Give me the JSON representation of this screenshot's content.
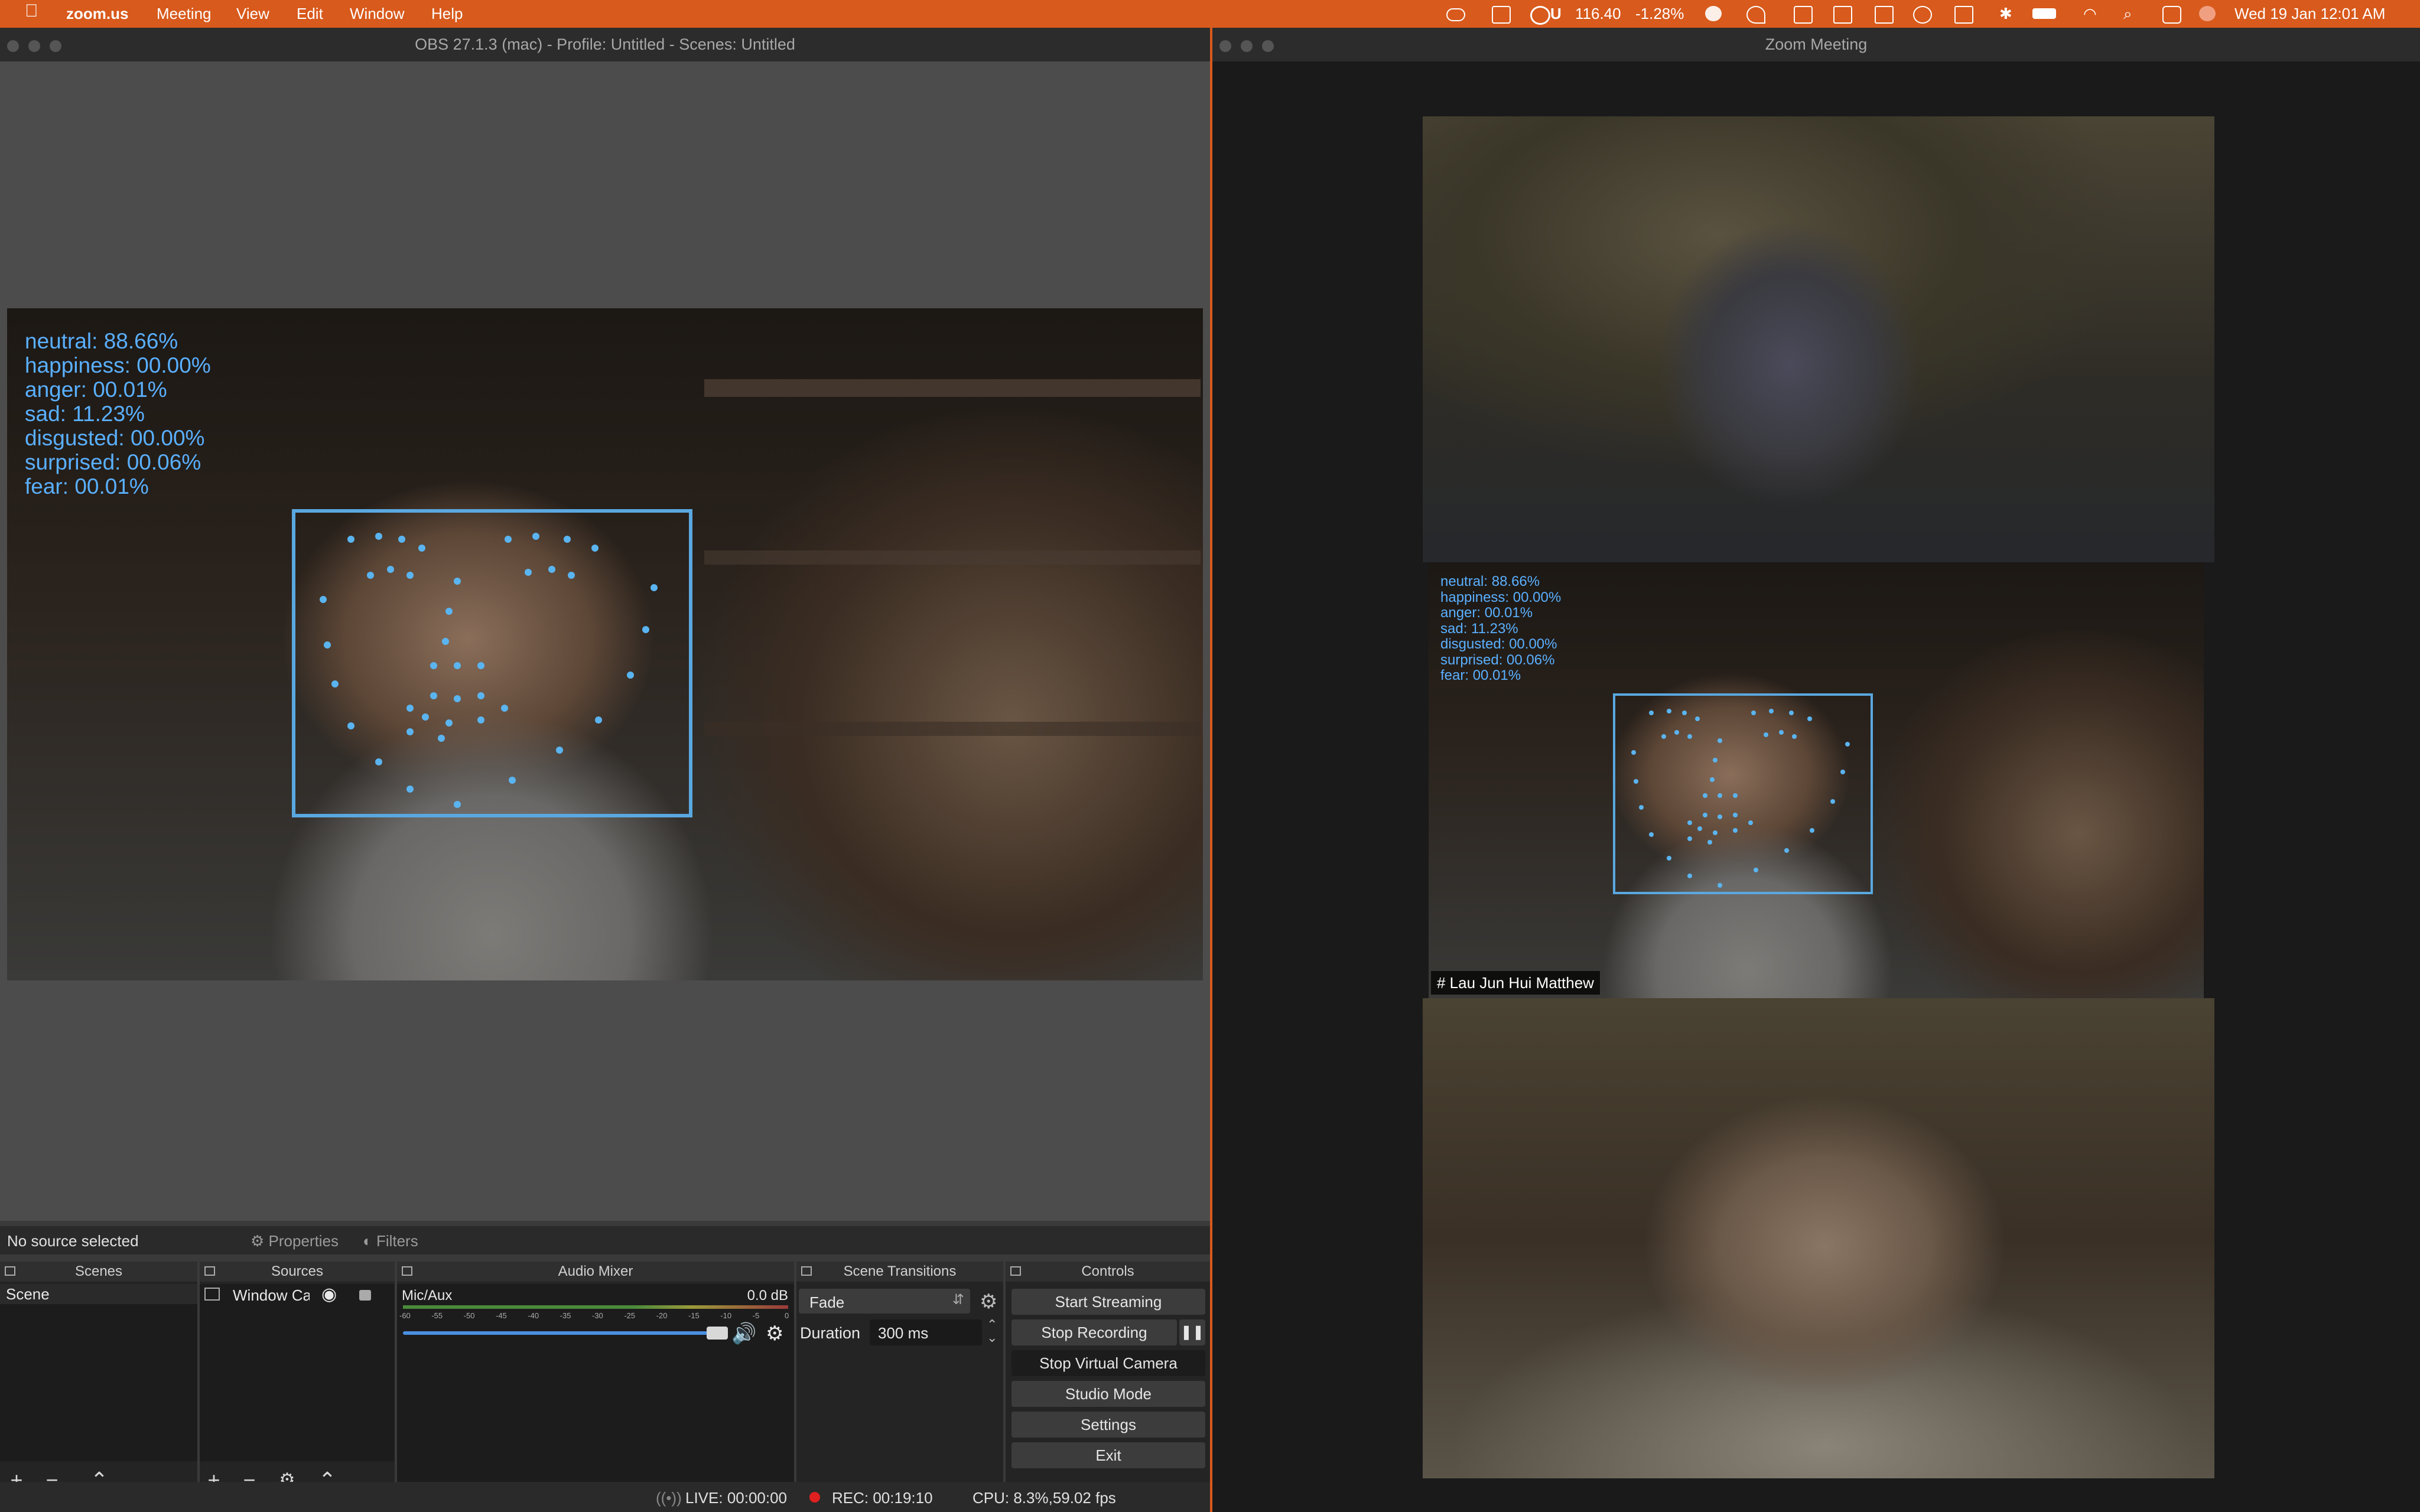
{
  "menubar": {
    "app": "zoom.us",
    "menus": [
      "Meeting",
      "View",
      "Edit",
      "Window",
      "Help"
    ],
    "stock": "116.40",
    "stock_change": "-1.28%",
    "stock_ticker": "U",
    "datetime": "Wed 19 Jan  12:01 AM"
  },
  "obs": {
    "title": "OBS 27.1.3 (mac) - Profile: Untitled - Scenes: Untitled",
    "emotions": [
      "neutral: 88.66%",
      "happiness: 00.00%",
      "anger: 00.01%",
      "sad: 11.23%",
      "disgusted: 00.00%",
      "surprised: 00.06%",
      "fear: 00.01%"
    ],
    "source_bar": {
      "no_source": "No source selected",
      "properties": "Properties",
      "filters": "Filters"
    },
    "scenes": {
      "title": "Scenes",
      "items": [
        "Scene"
      ]
    },
    "sources": {
      "title": "Sources",
      "items": [
        "Window Ca"
      ]
    },
    "audio": {
      "title": "Audio Mixer",
      "channel": "Mic/Aux",
      "db": "0.0 dB",
      "ticks": [
        "-60",
        "-55",
        "-50",
        "-45",
        "-40",
        "-35",
        "-30",
        "-25",
        "-20",
        "-15",
        "-10",
        "-5",
        "0"
      ]
    },
    "transitions": {
      "title": "Scene Transitions",
      "type": "Fade",
      "duration_label": "Duration",
      "duration": "300 ms"
    },
    "controls": {
      "title": "Controls",
      "start_streaming": "Start Streaming",
      "stop_recording": "Stop Recording",
      "stop_virtual_camera": "Stop Virtual Camera",
      "studio_mode": "Studio Mode",
      "settings": "Settings",
      "exit": "Exit"
    },
    "status": {
      "live": "LIVE: 00:00:00",
      "rec": "REC: 00:19:10",
      "cpu": "CPU: 8.3%,59.02 fps"
    }
  },
  "zoom": {
    "title": "Zoom Meeting",
    "participant": "# Lau Jun Hui Matthew"
  },
  "colors": {
    "menubar": "#d85a1c",
    "emotion_text": "#5ab0ff",
    "face_box": "#5aa8e0",
    "rec_dot": "#e02020"
  }
}
